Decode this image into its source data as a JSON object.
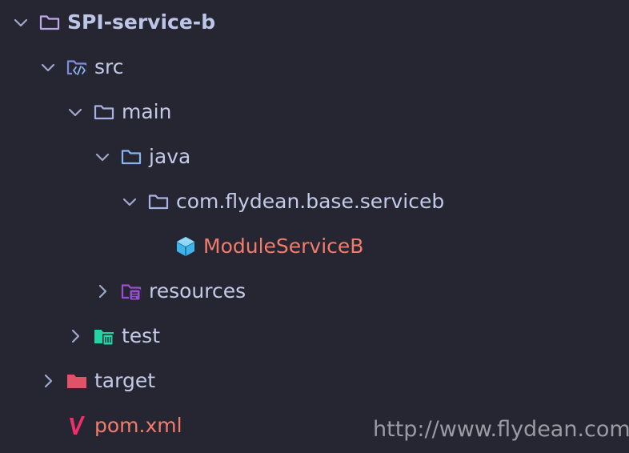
{
  "tree": {
    "items": [
      {
        "label": "SPI-service-b",
        "icon": "folder-icon",
        "expanded": true,
        "color": "#c0a7e8"
      },
      {
        "label": "src",
        "icon": "source-folder-icon",
        "expanded": true,
        "color": "#7d8ee0"
      },
      {
        "label": "main",
        "icon": "folder-icon",
        "expanded": true,
        "color": "#a6b2e3"
      },
      {
        "label": "java",
        "icon": "folder-icon",
        "expanded": true,
        "color": "#8ab3f2"
      },
      {
        "label": "com.flydean.base.serviceb",
        "icon": "folder-icon",
        "expanded": true,
        "color": "#a6b2e3"
      },
      {
        "label": "ModuleServiceB",
        "icon": "java-class-icon",
        "color": "#3fb4e8"
      },
      {
        "label": "resources",
        "icon": "resources-folder-icon",
        "expanded": false,
        "color": "#9b4fd0"
      },
      {
        "label": "test",
        "icon": "test-folder-icon",
        "expanded": false,
        "color": "#25d4a4"
      },
      {
        "label": "target",
        "icon": "folder-icon",
        "expanded": false,
        "color": "#e05268"
      },
      {
        "label": "pom.xml",
        "icon": "maven-icon",
        "color": "#f02e6a"
      }
    ]
  },
  "watermark": "http://www.flydean.com",
  "colors": {
    "background": "#252632",
    "text": "#c3cae8",
    "highlight_text": "#f27c6c",
    "chevron": "#a0a8cc"
  }
}
